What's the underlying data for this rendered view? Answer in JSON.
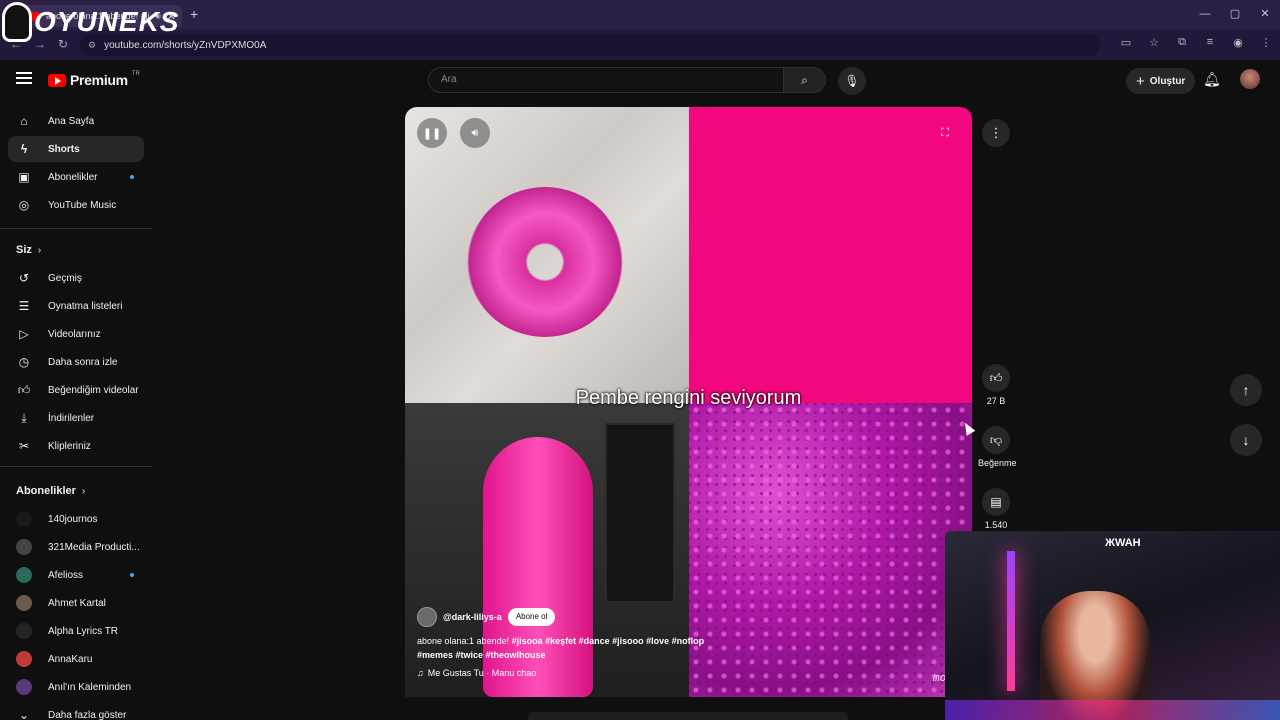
{
  "browser": {
    "tab_title": "abone olana:1 abende! #jis",
    "tab_close": "✕",
    "new_tab": "+",
    "url": "youtube.com/shorts/yZnVDPXMO0A",
    "window_controls": [
      "—",
      "▢",
      "✕"
    ]
  },
  "overlay_logo": "OYUNEKS",
  "masthead": {
    "brand": "Premium",
    "region": "TR",
    "search_placeholder": "Ara",
    "create_label": "Oluştur"
  },
  "sidebar": {
    "main": [
      {
        "label": "Ana Sayfa",
        "icon": "home-icon"
      },
      {
        "label": "Shorts",
        "icon": "shorts-icon",
        "active": true
      },
      {
        "label": "Abonelikler",
        "icon": "subscriptions-icon",
        "dot": true
      },
      {
        "label": "YouTube Music",
        "icon": "music-icon"
      }
    ],
    "you_heading": "Siz",
    "you_items": [
      {
        "label": "Geçmiş",
        "icon": "history-icon"
      },
      {
        "label": "Oynatma listeleri",
        "icon": "playlists-icon"
      },
      {
        "label": "Videolarınız",
        "icon": "your-videos-icon"
      },
      {
        "label": "Daha sonra izle",
        "icon": "watch-later-icon"
      },
      {
        "label": "Beğendiğim videolar",
        "icon": "liked-icon"
      },
      {
        "label": "İndirilenler",
        "icon": "downloads-icon"
      },
      {
        "label": "Klipleriniz",
        "icon": "clips-icon"
      }
    ],
    "subs_heading": "Abonelikler",
    "subscriptions": [
      {
        "label": "140journos",
        "color": "#1a1a1a"
      },
      {
        "label": "321Media Producti...",
        "color": "#444444"
      },
      {
        "label": "Afelioss",
        "color": "#2a6a5a",
        "dot": true
      },
      {
        "label": "Ahmet Kartal",
        "color": "#6a5a4a"
      },
      {
        "label": "Alpha Lyrics TR",
        "color": "#222222"
      },
      {
        "label": "AnnaKaru",
        "color": "#c03a3a"
      },
      {
        "label": "Anıl'ın Kaleminden",
        "color": "#5a3a7a"
      }
    ],
    "show_more": "Daha fazla göster"
  },
  "short": {
    "caption": "Pembe rengini seviyorum",
    "channel": "@dark-liliys-a",
    "subscribe_label": "Abone ol",
    "desc_prefix": "abone olana:1 abende! ",
    "desc_tags_line1": "#jisooa #keşfet #dance #jisooo #love #noflop",
    "desc_tags_line2": "#memes #twice #theowlhouse",
    "music": "Me Gustas Tu · Manu chao",
    "watermark": "moonflower_a"
  },
  "actions": {
    "likes": "27 B",
    "dislike_label": "Beğenme",
    "comments": "1.540"
  },
  "webcam_sign": "ЖWAH"
}
